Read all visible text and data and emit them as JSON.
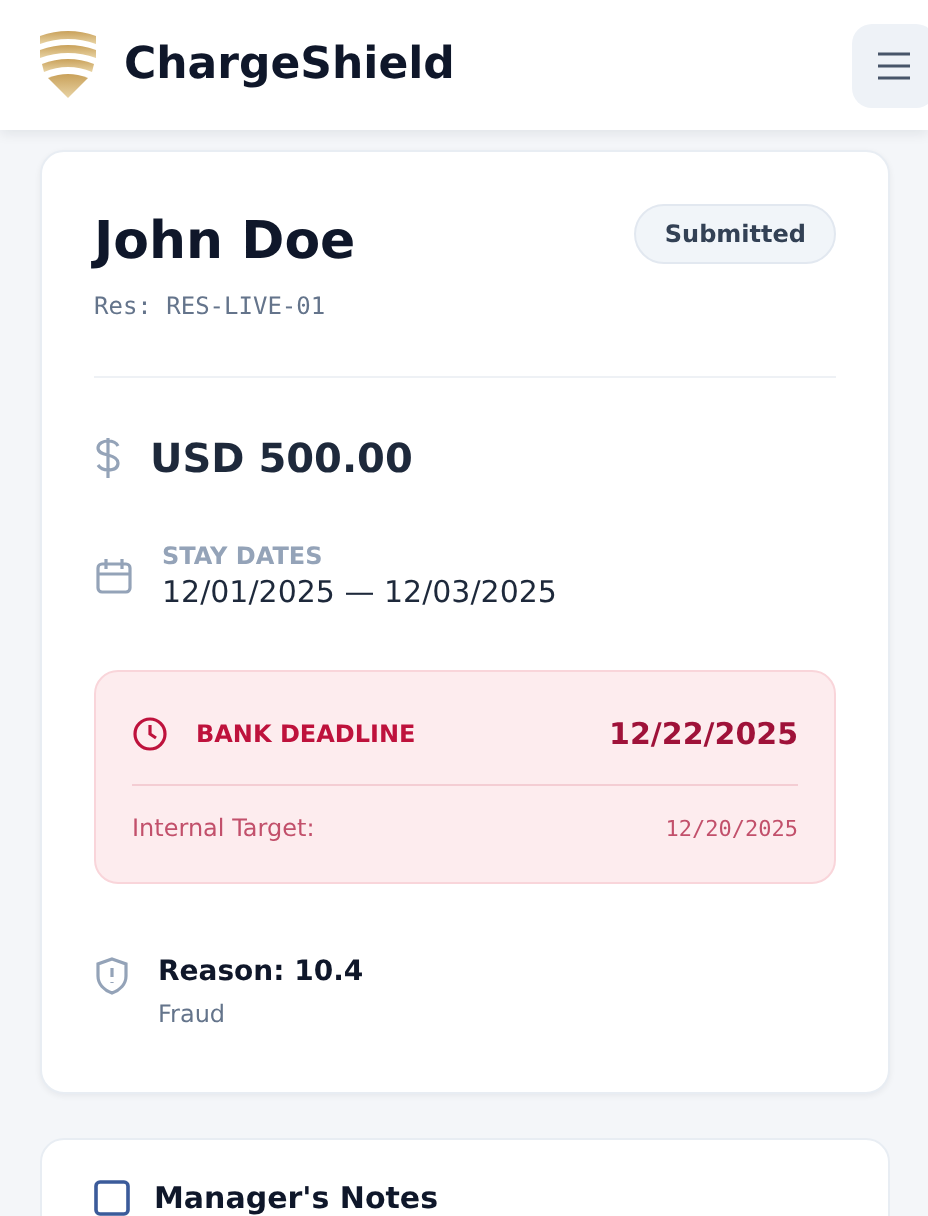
{
  "header": {
    "title": "ChargeShield"
  },
  "case": {
    "name": "John Doe",
    "status": "Submitted",
    "reservation": "Res: RES-LIVE-01",
    "amount": "USD 500.00",
    "stay_dates": {
      "label": "STAY DATES",
      "value": "12/01/2025 — 12/03/2025"
    },
    "deadline": {
      "label": "BANK DEADLINE",
      "date": "12/22/2025",
      "internal_label": "Internal Target:",
      "internal_date": "12/20/2025"
    },
    "reason": {
      "title": "Reason: 10.4",
      "detail": "Fraud"
    }
  },
  "notes_card": {
    "title": "Manager's Notes"
  }
}
